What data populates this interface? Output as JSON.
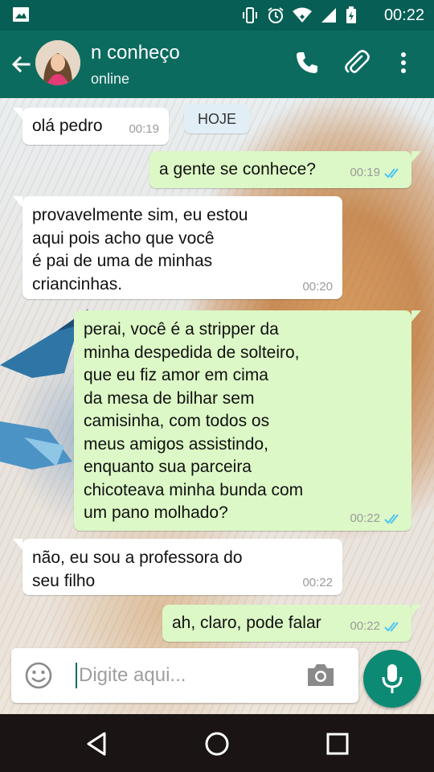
{
  "status_bar": {
    "time": "00:22",
    "icons": [
      "gallery-icon",
      "vibrate-icon",
      "alarm-icon",
      "wifi-icon",
      "signal-icon",
      "battery-charging-icon"
    ]
  },
  "header": {
    "contact_name": "n conheço",
    "status": "online",
    "actions": [
      "back-arrow-icon",
      "phone-icon",
      "paperclip-icon",
      "more-vert-icon"
    ]
  },
  "chat": {
    "date_chip": "HOJE",
    "messages": [
      {
        "direction": "in",
        "text": "olá pedro",
        "time": "00:19"
      },
      {
        "direction": "out",
        "text": "a gente se conhece?",
        "time": "00:19",
        "read": true
      },
      {
        "direction": "in",
        "text": "provavelmente sim, eu estou\naqui pois acho que você\né pai de uma de minhas\ncriancinhas.",
        "time": "00:20"
      },
      {
        "direction": "out",
        "text": "perai, você é a stripper da\nminha despedida de solteiro,\nque eu fiz amor em cima\nda mesa de bilhar sem\ncamisinha, com todos os\nmeus amigos assistindo,\nenquanto sua parceira\nchicoteava minha bunda com\num pano molhado?",
        "time": "00:22",
        "read": true
      },
      {
        "direction": "in",
        "text": "não, eu sou a professora do\nseu filho",
        "time": "00:22"
      },
      {
        "direction": "out",
        "text": "ah, claro, pode falar",
        "time": "00:22",
        "read": true
      }
    ]
  },
  "composer": {
    "placeholder": "Digite aqui..."
  },
  "colors": {
    "header": "#0c6b5f",
    "status_bar": "#075e54",
    "outgoing_bubble": "#dcf8c6",
    "incoming_bubble": "#ffffff",
    "read_ticks": "#4fc3f7",
    "mic_button": "#0d8a74"
  }
}
